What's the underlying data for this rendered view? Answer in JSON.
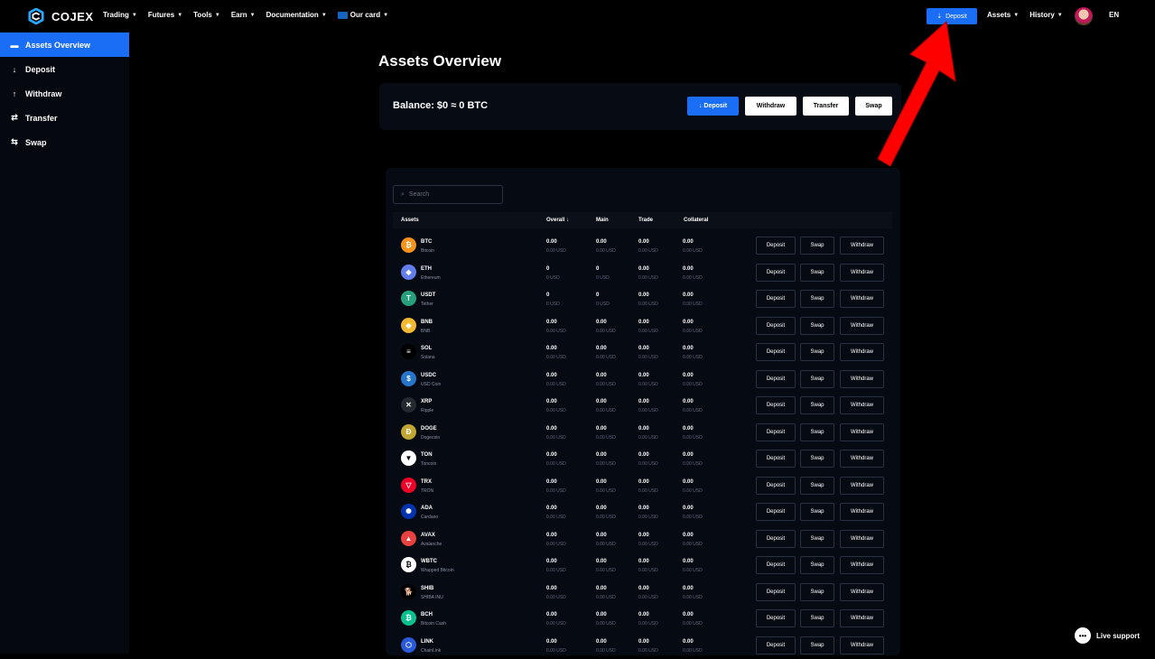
{
  "brand": {
    "name": "COJEX"
  },
  "nav": {
    "items": [
      "Trading",
      "Futures",
      "Tools",
      "Earn",
      "Documentation",
      "Our card"
    ]
  },
  "topbar": {
    "deposit_label": "Deposit",
    "assets_label": "Assets",
    "history_label": "History",
    "lang": "EN"
  },
  "sidebar": {
    "items": [
      {
        "label": "Assets Overview",
        "icon": "wallet-icon"
      },
      {
        "label": "Deposit",
        "icon": "arrow-down-icon"
      },
      {
        "label": "Withdraw",
        "icon": "arrow-up-icon"
      },
      {
        "label": "Transfer",
        "icon": "transfer-icon"
      },
      {
        "label": "Swap",
        "icon": "swap-icon"
      }
    ]
  },
  "main": {
    "title": "Assets Overview",
    "balance": "Balance: $0 ≈ 0 BTC",
    "buttons": {
      "deposit": "Deposit",
      "withdraw": "Withdraw",
      "transfer": "Transfer",
      "swap": "Swap"
    }
  },
  "table": {
    "search_placeholder": "Search",
    "headers": {
      "assets": "Assets",
      "overall": "Overall ↓",
      "main": "Main",
      "trade": "Trade",
      "collateral": "Collateral"
    },
    "row_buttons": {
      "deposit": "Deposit",
      "swap": "Swap",
      "withdraw": "Withdraw"
    },
    "rows": [
      {
        "symbol": "BTC",
        "name": "Bitcoin",
        "overall": "0.00",
        "main": "0.00",
        "trade": "0.00",
        "collateral": "0.00",
        "color": "#f7931a",
        "glyph": "₿"
      },
      {
        "symbol": "ETH",
        "name": "Ethereum",
        "overall": "0",
        "main": "0",
        "trade": "0.00",
        "collateral": "0.00",
        "color": "#627eea",
        "glyph": "◆"
      },
      {
        "symbol": "USDT",
        "name": "Tether",
        "overall": "0",
        "main": "0",
        "trade": "0.00",
        "collateral": "0.00",
        "color": "#26a17b",
        "glyph": "T"
      },
      {
        "symbol": "BNB",
        "name": "BNB",
        "overall": "0.00",
        "main": "0.00",
        "trade": "0.00",
        "collateral": "0.00",
        "color": "#f3ba2f",
        "glyph": "◈"
      },
      {
        "symbol": "SOL",
        "name": "Solana",
        "overall": "0.00",
        "main": "0.00",
        "trade": "0.00",
        "collateral": "0.00",
        "color": "#000000",
        "glyph": "≡"
      },
      {
        "symbol": "USDC",
        "name": "USD Coin",
        "overall": "0.00",
        "main": "0.00",
        "trade": "0.00",
        "collateral": "0.00",
        "color": "#2775ca",
        "glyph": "$"
      },
      {
        "symbol": "XRP",
        "name": "Ripple",
        "overall": "0.00",
        "main": "0.00",
        "trade": "0.00",
        "collateral": "0.00",
        "color": "#23292f",
        "glyph": "✕"
      },
      {
        "symbol": "DOGE",
        "name": "Dogecoin",
        "overall": "0.00",
        "main": "0.00",
        "trade": "0.00",
        "collateral": "0.00",
        "color": "#c2a633",
        "glyph": "Ð"
      },
      {
        "symbol": "TON",
        "name": "Toncoin",
        "overall": "0.00",
        "main": "0.00",
        "trade": "0.00",
        "collateral": "0.00",
        "color": "#ffffff",
        "glyph": "▼"
      },
      {
        "symbol": "TRX",
        "name": "TRON",
        "overall": "0.00",
        "main": "0.00",
        "trade": "0.00",
        "collateral": "0.00",
        "color": "#ef0027",
        "glyph": "▽"
      },
      {
        "symbol": "ADA",
        "name": "Cardano",
        "overall": "0.00",
        "main": "0.00",
        "trade": "0.00",
        "collateral": "0.00",
        "color": "#0033ad",
        "glyph": "✺"
      },
      {
        "symbol": "AVAX",
        "name": "Avalanche",
        "overall": "0.00",
        "main": "0.00",
        "trade": "0.00",
        "collateral": "0.00",
        "color": "#e84142",
        "glyph": "▲"
      },
      {
        "symbol": "WBTC",
        "name": "Wrapped Bitcoin",
        "overall": "0.00",
        "main": "0.00",
        "trade": "0.00",
        "collateral": "0.00",
        "color": "#ffffff",
        "glyph": "₿"
      },
      {
        "symbol": "SHIB",
        "name": "SHIBA INU",
        "overall": "0.00",
        "main": "0.00",
        "trade": "0.00",
        "collateral": "0.00",
        "color": "#000000",
        "glyph": "🐕"
      },
      {
        "symbol": "BCH",
        "name": "Bitcoin Cash",
        "overall": "0.00",
        "main": "0.00",
        "trade": "0.00",
        "collateral": "0.00",
        "color": "#0ac18e",
        "glyph": "₿"
      },
      {
        "symbol": "LINK",
        "name": "ChainLink",
        "overall": "0.00",
        "main": "0.00",
        "trade": "0.00",
        "collateral": "0.00",
        "color": "#2a5ada",
        "glyph": "⬡"
      }
    ],
    "usd_suffix": "0.00 USD",
    "usd_zero": "0 USD"
  },
  "live_support": "Live support",
  "colors": {
    "accent": "#1a6df5",
    "background": "#000000",
    "annotation_arrow": "#ff0000"
  }
}
